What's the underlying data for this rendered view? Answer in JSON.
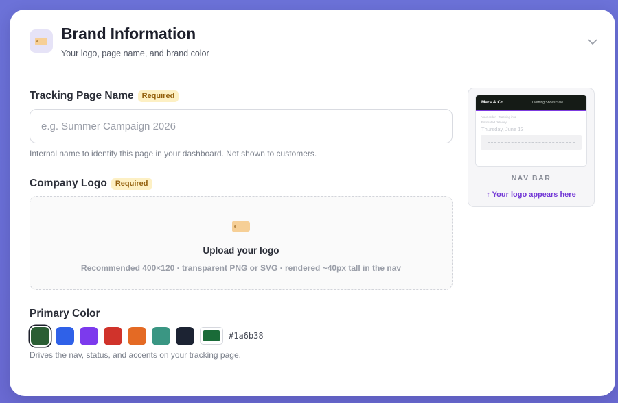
{
  "section": {
    "title": "Brand Information",
    "subtitle": "Your logo, page name, and brand color",
    "icon": "tag-icon",
    "collapse_icon": "chevron-down-icon"
  },
  "tracking_name": {
    "label": "Tracking Page Name",
    "badge": "Required",
    "placeholder": "e.g. Summer Campaign 2026",
    "value": "",
    "help": "Internal name to identify this page in your dashboard. Not shown to customers."
  },
  "logo": {
    "label": "Company Logo",
    "badge": "Required",
    "upload_icon": "tag-icon",
    "upload_title": "Upload your logo",
    "upload_hint": "Recommended 400×120 · transparent PNG or SVG · rendered ~40px tall in the nav"
  },
  "primary_color": {
    "label": "Primary Color",
    "swatches": [
      {
        "color": "#2b5e34",
        "selected": true
      },
      {
        "color": "#2f61e8",
        "selected": false
      },
      {
        "color": "#7c3aed",
        "selected": false
      },
      {
        "color": "#d0332b",
        "selected": false
      },
      {
        "color": "#e46a24",
        "selected": false
      },
      {
        "color": "#3a9683",
        "selected": false
      },
      {
        "color": "#1c2333",
        "selected": false
      }
    ],
    "custom_color": "#1a6b38",
    "hex_value": "#1a6b38",
    "help": "Drives the nav, status, and accents on your tracking page."
  },
  "preview": {
    "brand": "Mars & Co.",
    "nav_links": "Clothing  Shoes  Sale",
    "line1": "Your order · Tracking info",
    "line2": "Estimated delivery",
    "date": "Thursday, June 13",
    "caption": "NAV BAR",
    "hint": "↑ Your logo appears here",
    "nav_bg": "#151b16",
    "accent": "#7d3be0"
  }
}
